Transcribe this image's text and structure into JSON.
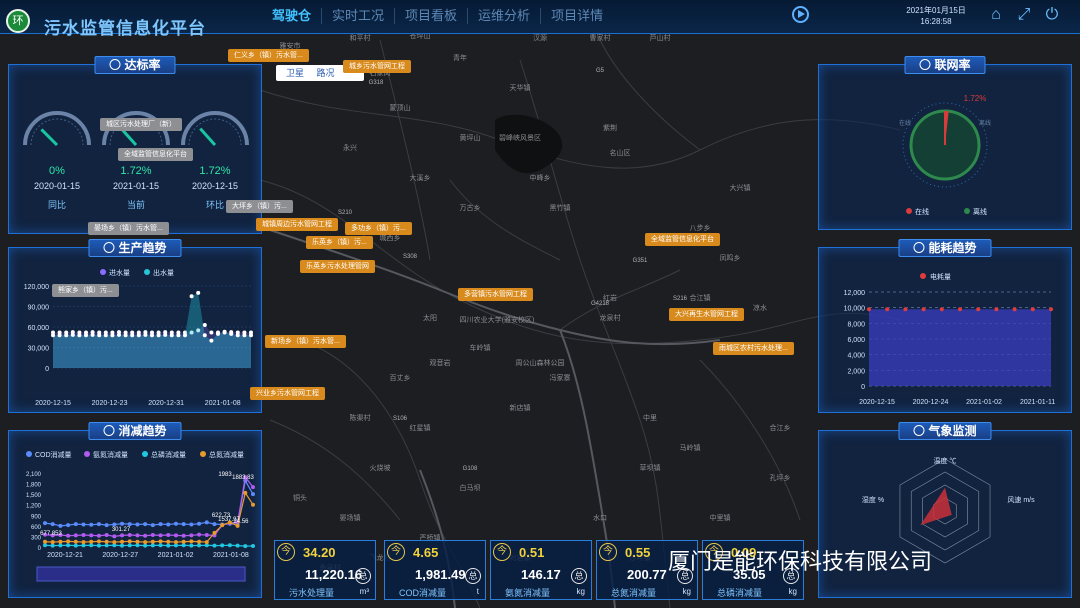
{
  "app": {
    "title": "污水监管信息化平台",
    "logo_text": "环"
  },
  "nav": {
    "tabs": [
      "驾驶仓",
      "实时工况",
      "项目看板",
      "运维分析",
      "项目详情"
    ],
    "active": "驾驶仓"
  },
  "datetime": {
    "date": "2021年01月15日",
    "time": "16:28:58"
  },
  "map": {
    "btn_sat": "卫星",
    "btn_road": "路况",
    "places": [
      "雅安市",
      "和平村",
      "苍坪山",
      "汉源",
      "曹家村",
      "芦山村",
      "石家岗",
      "青年",
      "天华镇",
      "蒙顶山",
      "黄坪山",
      "紫荆",
      "名山区",
      "永兴",
      "大溪乡",
      "中峰乡",
      "万古乡",
      "城西乡",
      "双河",
      "太阳",
      "红岩",
      "龙泉村",
      "黑竹镇",
      "观音岩",
      "百丈乡",
      "车岭镇",
      "冯家寨",
      "新店镇",
      "红星镇",
      "中里",
      "马岭镇",
      "陈渠村",
      "火烧坡",
      "白马坝",
      "周公山森林公园",
      "四川农业大学(雅安校区)",
      "碧峰峡风景区",
      "八步乡",
      "凤鸣乡",
      "合江镇",
      "凉水",
      "大兴镇",
      "草坝镇",
      "水口",
      "中里镇",
      "晏场镇",
      "严桥镇",
      "对岩镇",
      "沙坪镇",
      "飞龙村",
      "合江乡",
      "孔坪乡",
      "铜头",
      "鱼泉村"
    ],
    "roads": [
      "G318",
      "G5",
      "S210",
      "G351",
      "S106",
      "G108",
      "S216",
      "G4218",
      "S308"
    ]
  },
  "map_tags": [
    {
      "text": "仁义乡（镇）污水管...",
      "style": "orange"
    },
    {
      "text": "城乡污水管网工程",
      "style": "orange"
    },
    {
      "text": "城区污水处理厂（新）",
      "style": "gray"
    },
    {
      "text": "全域监管信息化平台",
      "style": "gray"
    },
    {
      "text": "大坪乡（镇）污...",
      "style": "gray"
    },
    {
      "text": "城镇周边污水管网工程",
      "style": "orange"
    },
    {
      "text": "多功乡（镇）污...",
      "style": "orange"
    },
    {
      "text": "乐英乡（镇）污...",
      "style": "orange"
    },
    {
      "text": "晏场乡（镇）污水管...",
      "style": "gray"
    },
    {
      "text": "乐英乡污水处理管网",
      "style": "orange"
    },
    {
      "text": "熊家乡（镇）污...",
      "style": "gray"
    },
    {
      "text": "全域监管信息化平台",
      "style": "orange"
    },
    {
      "text": "多营镇污水管网工程",
      "style": "orange"
    },
    {
      "text": "大兴再生水管网工程",
      "style": "orange"
    },
    {
      "text": "新场乡（镇）污水管...",
      "style": "orange"
    },
    {
      "text": "雨城区农村污水处理...",
      "style": "orange"
    },
    {
      "text": "兴业乡污水管网工程",
      "style": "orange"
    }
  ],
  "panels": {
    "rate": {
      "title": "达标率",
      "gauges": [
        {
          "value": "0%",
          "date": "2020-01-15",
          "label": "同比",
          "pct": 0.0
        },
        {
          "value": "1.72%",
          "date": "2021-01-15",
          "label": "当前",
          "pct": 0.0172
        },
        {
          "value": "1.72%",
          "date": "2020-12-15",
          "label": "环比",
          "pct": 0.0172
        }
      ]
    },
    "network": {
      "title": "联网率",
      "value": "1.72%",
      "pct": 0.0172,
      "legend": [
        {
          "name": "在线",
          "color": "#d83b3b"
        },
        {
          "name": "离线",
          "color": "#2e8a4c"
        }
      ],
      "ring_labels": [
        "在线",
        "离线"
      ]
    },
    "production": {
      "title": "生产趋势",
      "legend": [
        {
          "name": "进水量",
          "color": "#8a6dff"
        },
        {
          "name": "出水量",
          "color": "#26c6d8"
        }
      ],
      "yticks": [
        "120,000",
        "90,000",
        "60,000",
        "30,000",
        "0"
      ],
      "xticks": [
        "2020-12-15",
        "2020-12-23",
        "2020-12-31",
        "2021-01-08"
      ]
    },
    "energy": {
      "title": "能耗趋势",
      "legend": [
        {
          "name": "电耗量",
          "color": "#e23b3b"
        }
      ],
      "yticks": [
        "12,000",
        "10,000",
        "8,000",
        "6,000",
        "4,000",
        "2,000",
        "0"
      ],
      "xticks": [
        "2020-12-15",
        "2020-12-24",
        "2021-01-02",
        "2021-01-11"
      ]
    },
    "reduction": {
      "title": "消减趋势",
      "legend": [
        {
          "name": "COD消减量",
          "color": "#5b8cff"
        },
        {
          "name": "氨氮消减量",
          "color": "#b25bf0"
        },
        {
          "name": "总磷消减量",
          "color": "#21c7e0"
        },
        {
          "name": "总氮消减量",
          "color": "#e89a2c"
        }
      ],
      "yticks": [
        "2,100",
        "1,800",
        "1,500",
        "1,200",
        "900",
        "600",
        "300",
        "0"
      ],
      "xticks": [
        "2020-12-21",
        "2020-12-27",
        "2021-01-02",
        "2021-01-08"
      ],
      "annotations": [
        "677.853",
        "301.27",
        "622.73",
        "1983",
        "1883.83",
        "1537.97",
        "24.56"
      ]
    },
    "weather": {
      "title": "气象监测",
      "labels": [
        "温度 ℃",
        "风速 m/s",
        "湿度 %"
      ]
    }
  },
  "kpis": [
    {
      "today": "34.20",
      "total": "11,220.16",
      "label": "污水处理量",
      "unit": "m³"
    },
    {
      "today": "4.65",
      "total": "1,981.49",
      "label": "COD消减量",
      "unit": "t"
    },
    {
      "today": "0.51",
      "total": "146.17",
      "label": "氨氮消减量",
      "unit": "kg"
    },
    {
      "today": "0.55",
      "total": "200.77",
      "label": "总氮消减量",
      "unit": "kg"
    },
    {
      "today": "0.09",
      "total": "35.05",
      "label": "总磷消减量",
      "unit": "kg"
    }
  ],
  "kpi_badges": {
    "today": "今",
    "total": "总"
  },
  "watermark": "厦门是能环保科技有限公司",
  "chart_data": [
    {
      "type": "area",
      "title": "生产趋势",
      "x": [
        "2020-12-15",
        "2020-12-16",
        "2020-12-17",
        "2020-12-18",
        "2020-12-19",
        "2020-12-20",
        "2020-12-21",
        "2020-12-22",
        "2020-12-23",
        "2020-12-24",
        "2020-12-25",
        "2020-12-26",
        "2020-12-27",
        "2020-12-28",
        "2020-12-29",
        "2020-12-30",
        "2020-12-31",
        "2021-01-01",
        "2021-01-02",
        "2021-01-03",
        "2021-01-04",
        "2021-01-05",
        "2021-01-06",
        "2021-01-07",
        "2021-01-08",
        "2021-01-09",
        "2021-01-10",
        "2021-01-11",
        "2021-01-12",
        "2021-01-13",
        "2021-01-14"
      ],
      "series": [
        {
          "name": "进水量",
          "values": [
            52000,
            52000,
            52000,
            52500,
            52000,
            52000,
            52500,
            52000,
            52000,
            52000,
            52500,
            52000,
            52000,
            52000,
            52500,
            52000,
            52000,
            52500,
            52000,
            52000,
            52000,
            52000,
            55000,
            63000,
            52000,
            52000,
            53000,
            52500,
            52000,
            52000,
            52000
          ]
        },
        {
          "name": "出水量",
          "values": [
            48000,
            48000,
            48000,
            48500,
            48000,
            48000,
            48500,
            48000,
            48000,
            48000,
            48500,
            48000,
            48000,
            48000,
            48500,
            48000,
            48000,
            48500,
            48000,
            48000,
            48000,
            105000,
            110000,
            48000,
            40000,
            50000,
            52000,
            50000,
            48000,
            48000,
            48000
          ]
        }
      ],
      "ylim": [
        0,
        120000
      ]
    },
    {
      "type": "area",
      "title": "能耗趋势",
      "x": [
        "2020-12-15",
        "2020-12-18",
        "2020-12-21",
        "2020-12-24",
        "2020-12-27",
        "2020-12-30",
        "2021-01-02",
        "2021-01-05",
        "2021-01-08",
        "2021-01-11",
        "2021-01-14"
      ],
      "series": [
        {
          "name": "电耗量",
          "values": [
            9800,
            9800,
            9800,
            9800,
            9800,
            9800,
            9800,
            9800,
            9800,
            9800,
            9800
          ]
        }
      ],
      "ylim": [
        0,
        12000
      ]
    },
    {
      "type": "line",
      "title": "消减趋势",
      "x": [
        "2020-12-18",
        "2020-12-19",
        "2020-12-20",
        "2020-12-21",
        "2020-12-22",
        "2020-12-23",
        "2020-12-24",
        "2020-12-25",
        "2020-12-26",
        "2020-12-27",
        "2020-12-28",
        "2020-12-29",
        "2020-12-30",
        "2020-12-31",
        "2021-01-01",
        "2021-01-02",
        "2021-01-03",
        "2021-01-04",
        "2021-01-05",
        "2021-01-06",
        "2021-01-07",
        "2021-01-08",
        "2021-01-09",
        "2021-01-10",
        "2021-01-11",
        "2021-01-12",
        "2021-01-13",
        "2021-01-14"
      ],
      "series": [
        {
          "name": "COD消减量",
          "values": [
            677,
            650,
            600,
            620,
            650,
            640,
            630,
            650,
            620,
            640,
            660,
            650,
            640,
            650,
            620,
            650,
            640,
            660,
            650,
            640,
            660,
            700,
            650,
            640,
            660,
            650,
            1883,
            1500
          ]
        },
        {
          "name": "氨氮消减量",
          "values": [
            350,
            330,
            340,
            320,
            330,
            340,
            330,
            320,
            340,
            301,
            330,
            340,
            330,
            320,
            340,
            330,
            340,
            330,
            320,
            330,
            350,
            340,
            330,
            620,
            680,
            700,
            1983,
            1700
          ]
        },
        {
          "name": "总磷消减量",
          "values": [
            50,
            40,
            45,
            50,
            40,
            45,
            50,
            40,
            45,
            50,
            40,
            45,
            50,
            40,
            45,
            50,
            40,
            45,
            50,
            40,
            45,
            50,
            40,
            45,
            50,
            40,
            24,
            30
          ]
        },
        {
          "name": "总氮消减量",
          "values": [
            150,
            140,
            150,
            160,
            150,
            140,
            150,
            160,
            150,
            140,
            150,
            160,
            150,
            140,
            150,
            160,
            150,
            140,
            150,
            160,
            150,
            140,
            400,
            622,
            700,
            600,
            1537,
            1200
          ]
        }
      ],
      "ylim": [
        0,
        2100
      ]
    },
    {
      "type": "radar",
      "title": "气象监测",
      "axes": [
        "温度 ℃",
        "风速 m/s",
        "湿度 %"
      ],
      "values": [
        0.45,
        0.15,
        0.55
      ]
    }
  ]
}
